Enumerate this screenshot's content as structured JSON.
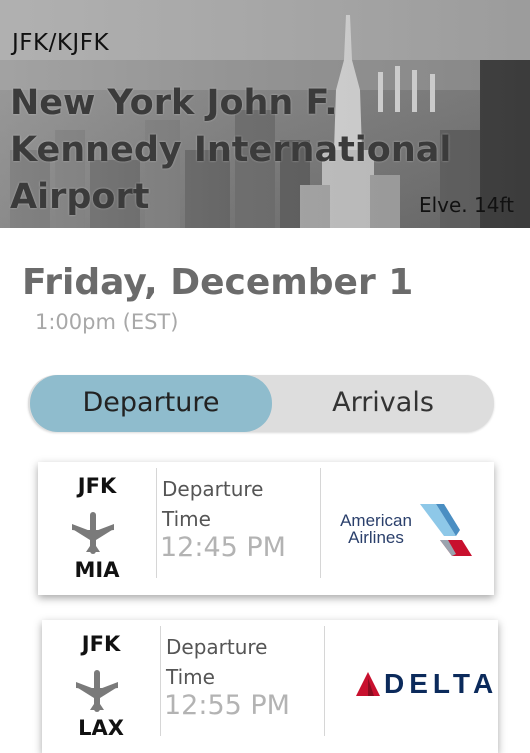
{
  "airport": {
    "code": "JFK/KJFK",
    "name": "New York John F. Kennedy International Airport",
    "elevation": "Elve. 14ft"
  },
  "schedule": {
    "date": "Friday, December 1",
    "time": "1:00pm (EST)"
  },
  "toggle": {
    "departure_label": "Departure",
    "arrivals_label": "Arrivals",
    "active": "Departure"
  },
  "flights": [
    {
      "from": "JFK",
      "to": "MIA",
      "label": "Departure Time",
      "time": "12:45 PM",
      "airline": "American Airlines",
      "airline_text": "American Airlines",
      "icon": "airplane-icon"
    },
    {
      "from": "JFK",
      "to": "LAX",
      "label": "Departure Time",
      "time": "12:55 PM",
      "airline": "Delta",
      "airline_text": "DELTA",
      "icon": "airplane-icon"
    }
  ],
  "colors": {
    "active_tab": "#8fbccd",
    "toggle_bg": "#dddddd",
    "date_text": "#6b6b6b",
    "aa_blue": "#2a3f6b",
    "delta_red": "#c8102e",
    "delta_blue": "#0b2a5b"
  }
}
